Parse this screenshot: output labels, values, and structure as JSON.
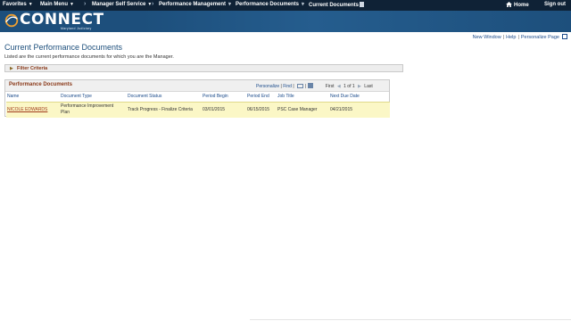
{
  "topnav": {
    "favorites": "Favorites",
    "main_menu": "Main Menu",
    "manager_self_service": "Manager Self Service",
    "performance_management": "Performance Management",
    "performance_documents": "Performance Documents",
    "current_documents": "Current Documents",
    "home": "Home",
    "sign_out": "Sign out"
  },
  "brand": {
    "logo_text": "CONNECT",
    "logo_sub": "Maryland Judiciary"
  },
  "pagelinks": {
    "new_window": "New Window",
    "help": "Help",
    "personalize_page": "Personalize Page"
  },
  "page": {
    "title": "Current Performance Documents",
    "instructions": "Listed are the current performance documents for which you are the Manager."
  },
  "filter": {
    "label": "Filter Criteria"
  },
  "grid": {
    "title": "Performance Documents",
    "personalize": "Personalize",
    "find": "Find",
    "first": "First",
    "range": "1 of 1",
    "last": "Last",
    "columns": [
      "Name",
      "Document Type",
      "Document Status",
      "Period Begin",
      "Period End",
      "Job Title",
      "Next Due Date"
    ],
    "rows": [
      {
        "name": "NICOLE EDWARDS",
        "doc_type_line1": "Performance Improvement",
        "doc_type_line2": "Plan",
        "status": "Track Progress - Finalize Criteria",
        "period_begin": "03/01/2015",
        "period_end": "06/15/2015",
        "job_title": "PSC Case Manager",
        "next_due": "04/21/2015"
      }
    ]
  },
  "colors": {
    "nav_bg": "#0f2236",
    "banner_bg": "#1d4f7c",
    "link_blue": "#1a4a8a",
    "section_brown": "#8a3a1a",
    "row_highlight": "#fbf7c6"
  }
}
